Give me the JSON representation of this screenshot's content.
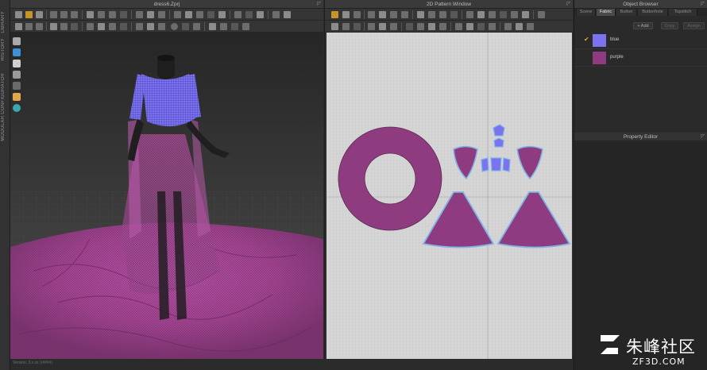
{
  "left_strip": {
    "tabs": [
      "LIBRARY",
      "HISTORY",
      "MODULAR CONFIGURATOR"
    ]
  },
  "pane3d": {
    "title": "dress6.Zprj"
  },
  "pane2d": {
    "title": "2D Pattern Window"
  },
  "object_browser": {
    "title": "Object Browser",
    "tabs": [
      "Scene",
      "Fabric",
      "Button",
      "Buttonhole",
      "Topstitch"
    ],
    "active_tab": "Fabric",
    "add_label": "+ Add",
    "copy_label": "Copy",
    "assign_label": "Assign",
    "fabrics": [
      {
        "name": "blue",
        "color": "#7b72f0",
        "checked": true
      },
      {
        "name": "purple",
        "color": "#8e3c7f",
        "checked": false
      }
    ]
  },
  "property_editor": {
    "title": "Property Editor"
  },
  "version_text": "Version: 3.x.xx (r####)",
  "watermark": {
    "main": "朱峰社区",
    "sub": "ZF3D.COM"
  },
  "colors": {
    "accent": "#e0a526",
    "fabric_purple": "#8e3c7f",
    "fabric_blue": "#7b72f0",
    "pattern_outline": "#7fb3e8"
  }
}
